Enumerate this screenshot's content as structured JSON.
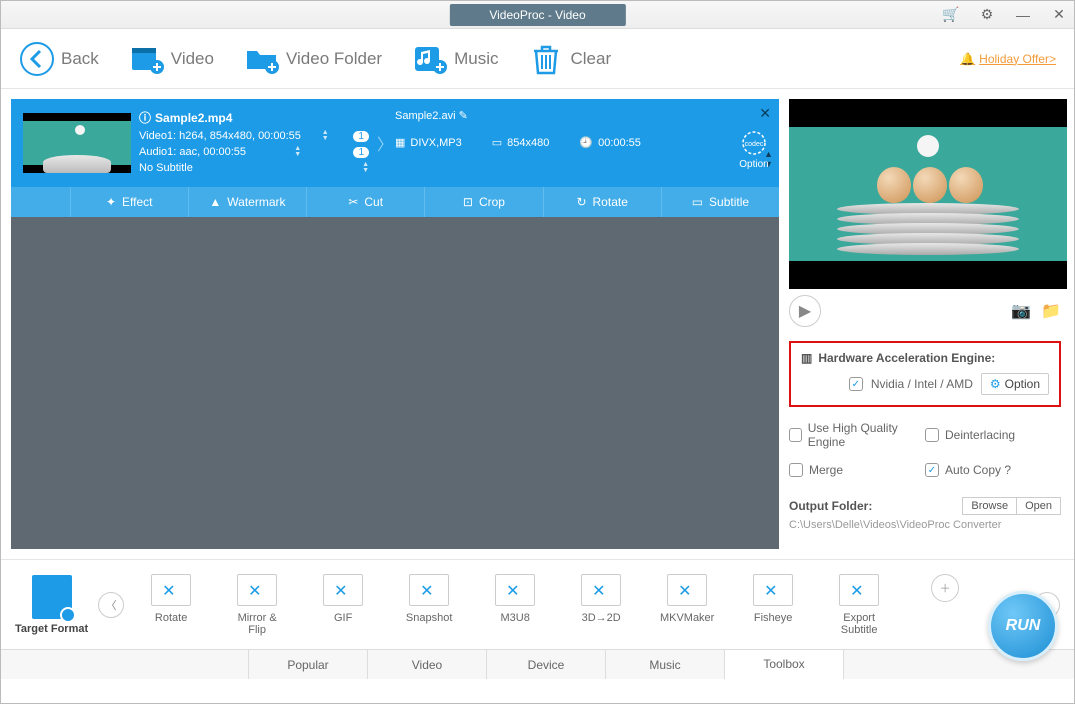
{
  "window": {
    "title": "VideoProc - Video"
  },
  "toolbar": {
    "back": "Back",
    "video": "Video",
    "video_folder": "Video Folder",
    "music": "Music",
    "clear": "Clear",
    "holiday_offer": "Holiday Offer>"
  },
  "clip": {
    "source": {
      "filename": "Sample2.mp4",
      "video_line": "Video1: h264, 854x480, 00:00:55",
      "audio_line": "Audio1: aac, 00:00:55",
      "subtitle_line": "No Subtitle",
      "video_badge": "1",
      "audio_badge": "1"
    },
    "dest": {
      "filename": "Sample2.avi",
      "codec": "DIVX,MP3",
      "resolution": "854x480",
      "duration": "00:00:55"
    },
    "option_label": "Option",
    "actions": {
      "effect": "Effect",
      "watermark": "Watermark",
      "cut": "Cut",
      "crop": "Crop",
      "rotate": "Rotate",
      "subtitle": "Subtitle"
    }
  },
  "hardware": {
    "title": "Hardware Acceleration Engine:",
    "gpu_label": "Nvidia / Intel / AMD",
    "option_btn": "Option",
    "gpu_checked": true
  },
  "options": {
    "high_quality": {
      "label": "Use High Quality Engine",
      "checked": false
    },
    "deinterlacing": {
      "label": "Deinterlacing",
      "checked": false
    },
    "merge": {
      "label": "Merge",
      "checked": false
    },
    "auto_copy": {
      "label": "Auto Copy ?",
      "checked": true
    }
  },
  "output": {
    "label": "Output Folder:",
    "browse": "Browse",
    "open": "Open",
    "path": "C:\\Users\\Delle\\Videos\\VideoProc Converter"
  },
  "formats": {
    "target_label": "Target Format",
    "items": [
      "Rotate",
      "Mirror & Flip",
      "GIF",
      "Snapshot",
      "M3U8",
      "3D→2D",
      "MKVMaker",
      "Fisheye",
      "Export Subtitle"
    ]
  },
  "tabs": [
    "Popular",
    "Video",
    "Device",
    "Music",
    "Toolbox"
  ],
  "active_tab": "Toolbox",
  "run_label": "RUN"
}
